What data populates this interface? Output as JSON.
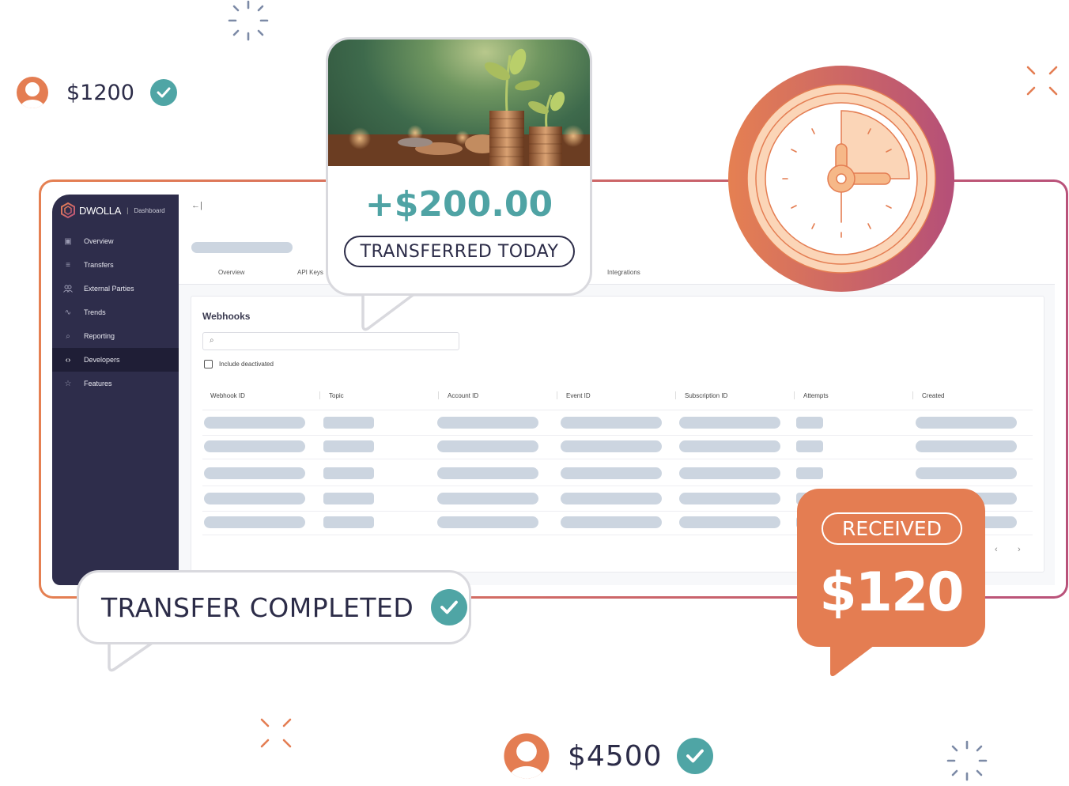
{
  "colors": {
    "accent_orange": "#e47d52",
    "accent_teal": "#4fa3a4",
    "accent_plum": "#b9527a",
    "sidebar_bg": "#2e2d4b",
    "text_dark": "#2c2c48",
    "skeleton": "#ccd5e0"
  },
  "balances": [
    {
      "amount": "$1200",
      "icon": "user-avatar-icon",
      "status_icon": "check-circle-icon"
    },
    {
      "amount": "$4500",
      "icon": "user-avatar-icon",
      "status_icon": "check-circle-icon"
    }
  ],
  "dashboard": {
    "brand": "DWOLLA",
    "brand_separator": "|",
    "brand_sub": "Dashboard",
    "collapse_icon": "←|",
    "sidebar": {
      "items": [
        {
          "label": "Overview",
          "icon": "overview-icon",
          "glyph": "▣",
          "active": false
        },
        {
          "label": "Transfers",
          "icon": "list-icon",
          "glyph": "≡",
          "active": false
        },
        {
          "label": "External Parties",
          "icon": "users-icon",
          "glyph": "👥",
          "active": false
        },
        {
          "label": "Trends",
          "icon": "trends-icon",
          "glyph": "∿",
          "active": false
        },
        {
          "label": "Reporting",
          "icon": "reporting-icon",
          "glyph": "⌕",
          "active": false
        },
        {
          "label": "Developers",
          "icon": "code-icon",
          "glyph": "‹›",
          "active": true
        },
        {
          "label": "Features",
          "icon": "star-icon",
          "glyph": "☆",
          "active": false
        }
      ]
    },
    "tabs": [
      {
        "label": "Overview"
      },
      {
        "label": "API Keys"
      },
      {
        "label": "Integrations"
      }
    ],
    "card": {
      "title": "Webhooks",
      "search_placeholder": "",
      "search_icon": "⌕",
      "include_deactivated_label": "Include deactivated",
      "include_deactivated_checked": false,
      "columns": [
        "Webhook ID",
        "Topic",
        "Account ID",
        "Event ID",
        "Subscription ID",
        "Attempts",
        "Created"
      ],
      "row_count": 5,
      "pager_prev": "‹",
      "pager_next": "›"
    }
  },
  "bubbles": {
    "transferred": {
      "amount": "+$200.00",
      "label": "TRANSFERRED TODAY"
    },
    "completed": {
      "label": "TRANSFER COMPLETED"
    },
    "received": {
      "label": "RECEIVED",
      "amount": "$120"
    }
  },
  "clock": {
    "icon": "clock-icon",
    "time_shown": "3:00"
  }
}
